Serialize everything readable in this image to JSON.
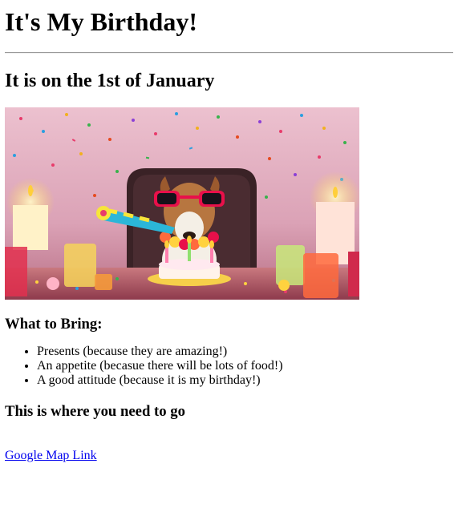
{
  "page": {
    "title": "It's My Birthday!",
    "subtitle": "It is on the 1st of January",
    "image_alt": "Dog in sunglasses blowing a party horn at a birthday table with candles and confetti"
  },
  "bring": {
    "heading": "What to Bring:",
    "items": [
      "Presents (because they are amazing!)",
      "An appetite (becasue there will be lots of food!)",
      "A good attitude (because it is my birthday!)"
    ]
  },
  "location": {
    "heading": "This is where you need to go",
    "link_text": "Google Map Link"
  },
  "colors": {
    "link": "#0000ee",
    "photo_background": "#e4b3c2",
    "sunglasses": "#e8104a",
    "party_horn": "#2bb6d8"
  }
}
